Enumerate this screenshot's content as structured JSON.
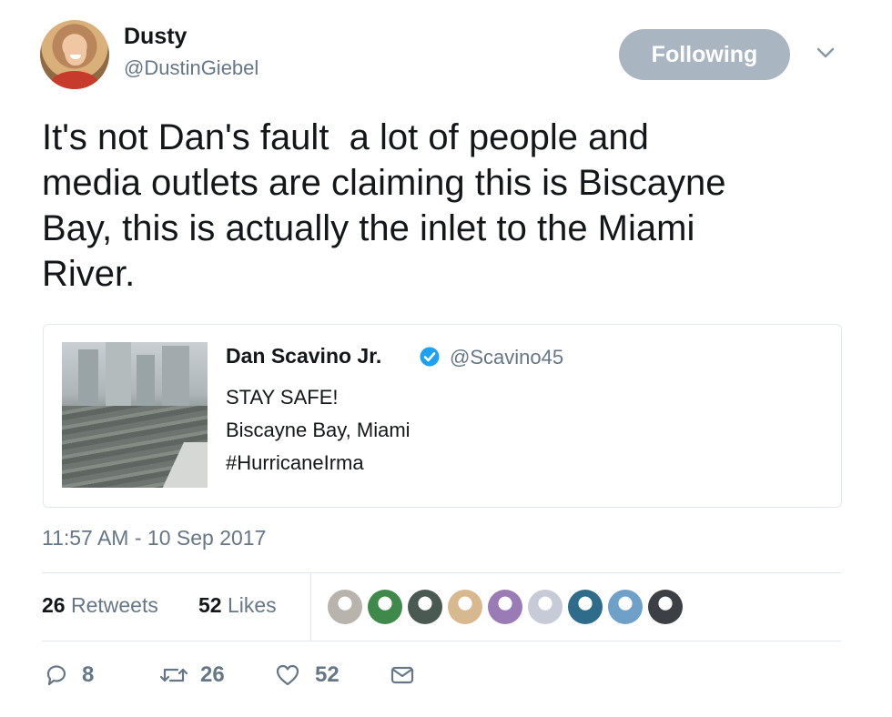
{
  "author": {
    "name": "Dusty",
    "handle": "@DustinGiebel"
  },
  "follow_button": {
    "label": "Following"
  },
  "tweet": {
    "text": "It's not Dan's fault  a lot of people and\nmedia outlets are claiming this is Biscayne\nBay, this is actually the inlet to the Miami\nRiver.",
    "timestamp": "11:57 AM - 10 Sep 2017"
  },
  "quoted_tweet": {
    "name": "Dan Scavino Jr.",
    "verified": true,
    "handle": "@Scavino45",
    "lines": [
      "STAY SAFE!",
      "Biscayne Bay, Miami",
      "#HurricaneIrma"
    ]
  },
  "stats": {
    "retweets_count": "26",
    "retweets_label": "Retweets",
    "likes_count": "52",
    "likes_label": "Likes"
  },
  "liker_avatars": [
    {
      "color": "#b9b3ad"
    },
    {
      "color": "#3f8a4a"
    },
    {
      "color": "#4a5a52"
    },
    {
      "color": "#d8b98f"
    },
    {
      "color": "#9a7bb5"
    },
    {
      "color": "#c7cbd8"
    },
    {
      "color": "#2f6b8a"
    },
    {
      "color": "#6fa0c8"
    },
    {
      "color": "#3c3f44"
    }
  ],
  "actions": {
    "reply_count": "8",
    "retweet_count": "26",
    "like_count": "52"
  },
  "colors": {
    "text_primary": "#14171a",
    "text_secondary": "#657786",
    "follow_button_bg": "#a9b6c2",
    "verified_blue": "#1da1f2",
    "border": "#e1e8ed"
  },
  "icons": [
    "chevron-down-icon",
    "verified-badge-icon",
    "reply-icon",
    "retweet-icon",
    "like-icon",
    "dm-icon"
  ]
}
